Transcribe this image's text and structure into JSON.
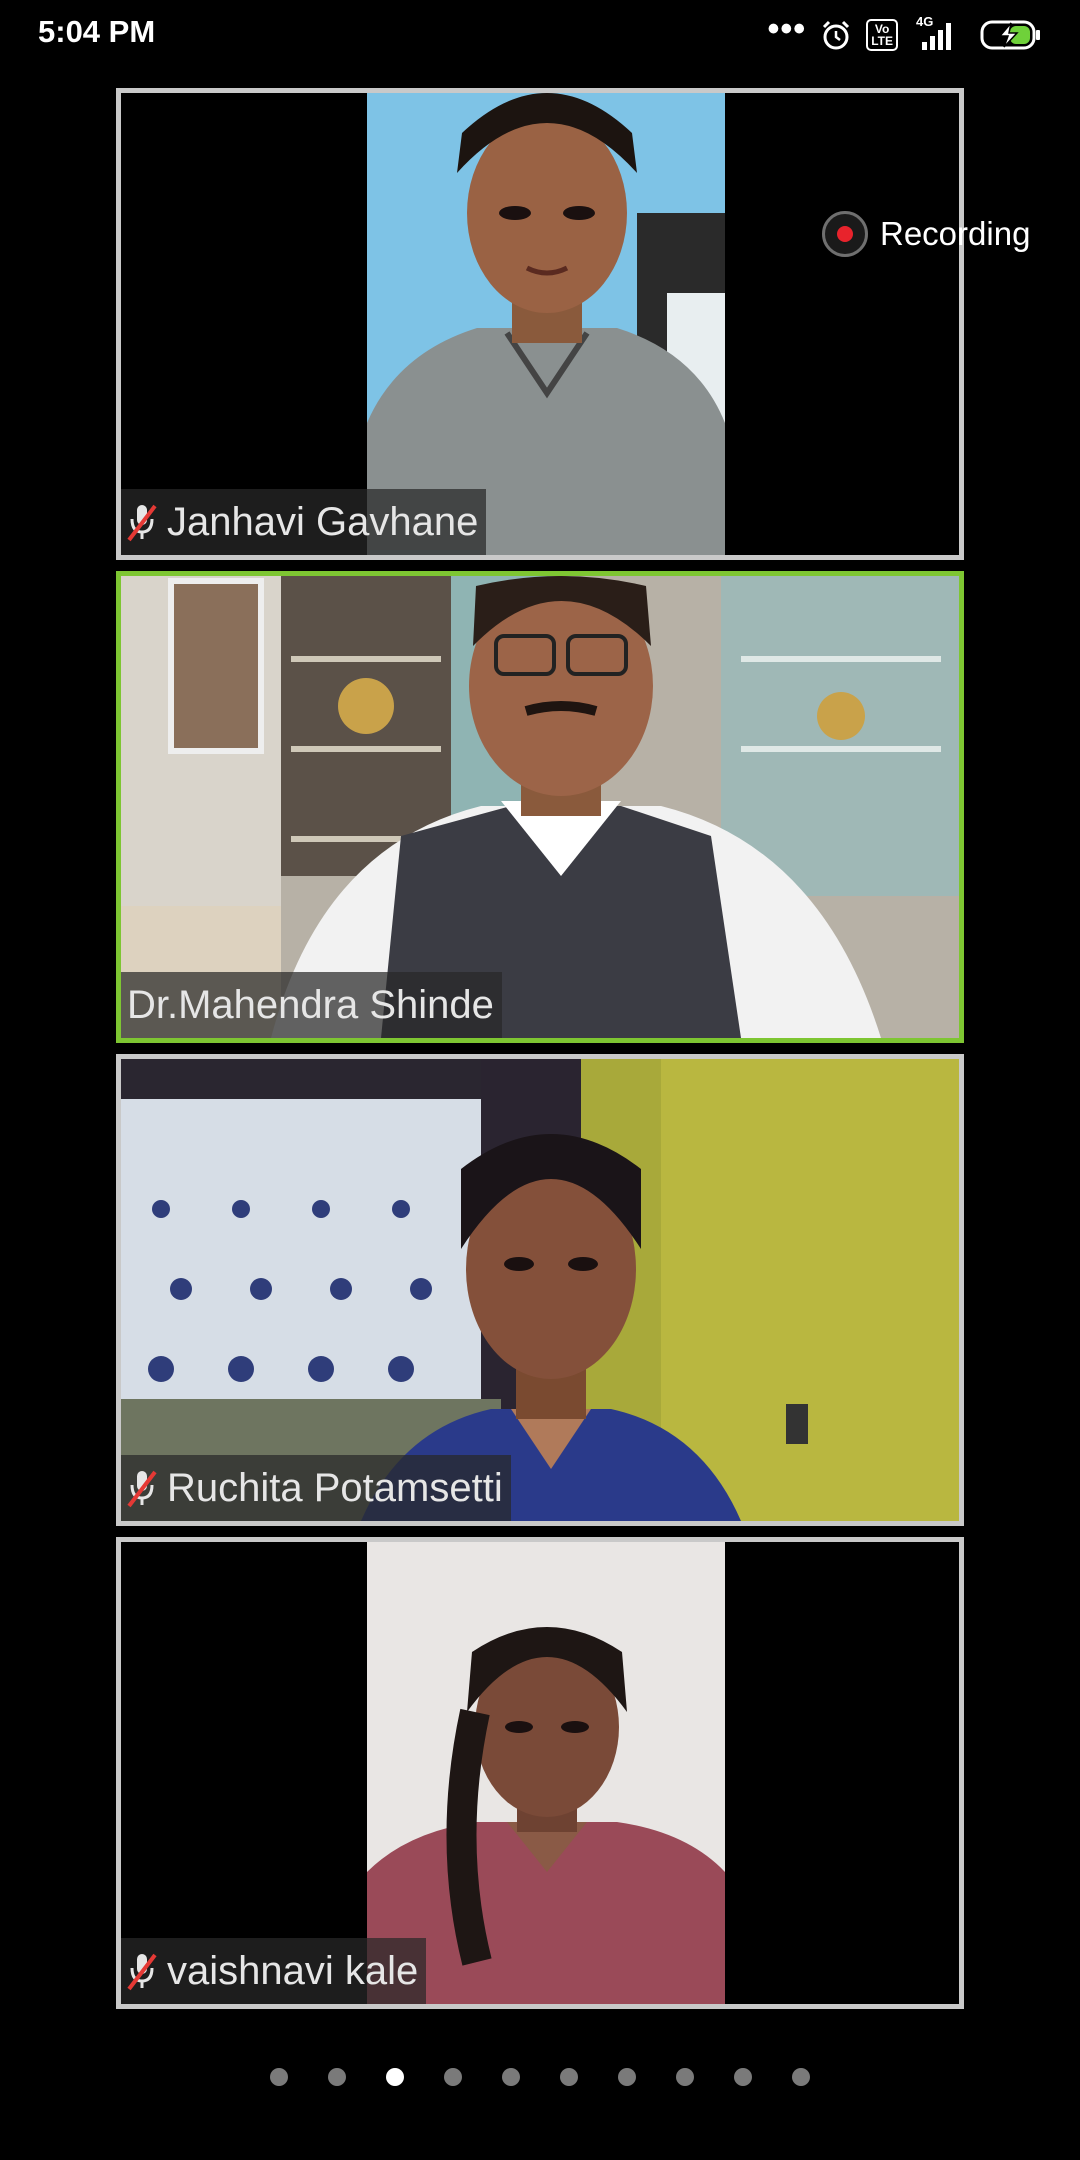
{
  "status_bar": {
    "time": "5:04 PM",
    "more": "•••",
    "volte": "Vo\nLTE",
    "network": "4G",
    "icons": [
      "more-dots-icon",
      "alarm-icon",
      "volte-icon",
      "signal-icon",
      "battery-charging-icon"
    ]
  },
  "recording": {
    "label": "Recording",
    "color": "#e8232c"
  },
  "participants": [
    {
      "name": "Janhavi Gavhane",
      "muted": true,
      "active": false
    },
    {
      "name": "Dr.Mahendra Shinde",
      "muted": false,
      "active": true
    },
    {
      "name": "Ruchita Potamsetti",
      "muted": true,
      "active": false
    },
    {
      "name": "vaishnavi kale",
      "muted": true,
      "active": false
    }
  ],
  "colors": {
    "active_speaker_border": "#7ec632",
    "tile_border": "#c9c9c9",
    "background": "#000000"
  },
  "pager": {
    "total": 10,
    "current": 3
  }
}
